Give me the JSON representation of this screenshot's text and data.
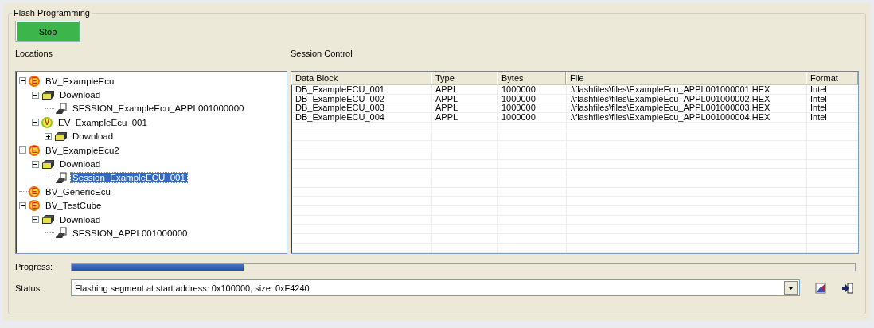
{
  "group": {
    "title": "Flash Programming"
  },
  "stop_button": {
    "label": "Stop"
  },
  "locations": {
    "label": "Locations",
    "tree": [
      {
        "kind": "ecu",
        "badge": "E",
        "label": "BV_ExampleEcu",
        "expanded": true,
        "selected": false,
        "children": [
          {
            "kind": "folder",
            "label": "Download",
            "expanded": true,
            "selected": false,
            "children": [
              {
                "kind": "session",
                "label": "SESSION_ExampleEcu_APPL001000000",
                "selected": false
              }
            ]
          },
          {
            "kind": "variant",
            "badge": "V",
            "label": "EV_ExampleEcu_001",
            "expanded": true,
            "selected": false,
            "children": [
              {
                "kind": "folder",
                "label": "Download",
                "expanded": false,
                "selected": false
              }
            ]
          }
        ]
      },
      {
        "kind": "ecu",
        "badge": "E",
        "label": "BV_ExampleEcu2",
        "expanded": true,
        "selected": false,
        "children": [
          {
            "kind": "folder",
            "label": "Download",
            "expanded": true,
            "selected": false,
            "children": [
              {
                "kind": "session",
                "label": "Session_ExampleECU_001",
                "selected": true
              }
            ]
          }
        ]
      },
      {
        "kind": "ecu",
        "badge": "E",
        "label": "BV_GenericEcu",
        "selected": false
      },
      {
        "kind": "ecu",
        "badge": "E",
        "label": "BV_TestCube",
        "expanded": true,
        "selected": false,
        "children": [
          {
            "kind": "folder",
            "label": "Download",
            "expanded": true,
            "selected": false,
            "children": [
              {
                "kind": "session",
                "label": "SESSION_APPL001000000",
                "selected": false
              }
            ]
          }
        ]
      }
    ]
  },
  "session_control": {
    "label": "Session Control",
    "table": {
      "columns": [
        "Data Block",
        "Type",
        "Bytes",
        "File",
        "Format"
      ],
      "rows": [
        [
          "DB_ExampleECU_001",
          "APPL",
          "1000000",
          ".\\flashfiles\\files\\ExampleEcu_APPL001000001.HEX",
          "Intel"
        ],
        [
          "DB_ExampleECU_002",
          "APPL",
          "1000000",
          ".\\flashfiles\\files\\ExampleEcu_APPL001000002.HEX",
          "Intel"
        ],
        [
          "DB_ExampleECU_003",
          "APPL",
          "1000000",
          ".\\flashfiles\\files\\ExampleEcu_APPL001000003.HEX",
          "Intel"
        ],
        [
          "DB_ExampleECU_004",
          "APPL",
          "1000000",
          ".\\flashfiles\\files\\ExampleEcu_APPL001000004.HEX",
          "Intel"
        ]
      ]
    }
  },
  "progress": {
    "label": "Progress:",
    "level": 0.22
  },
  "status": {
    "label": "Status:",
    "value": "Flashing segment at start address: 0x100000, size: 0xF4240"
  }
}
